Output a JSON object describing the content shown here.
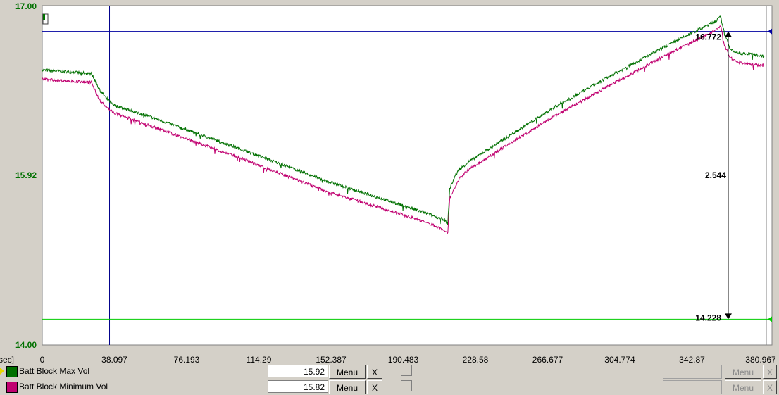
{
  "chart_data": {
    "type": "line",
    "x_axis": {
      "unit_label": "sec]",
      "range": [
        0,
        380.967
      ],
      "tick_labels": [
        "0",
        "38.097",
        "76.193",
        "114.29",
        "152.387",
        "190.483",
        "228.58",
        "266.677",
        "304.774",
        "342.87",
        "380.967"
      ]
    },
    "y_axis": {
      "range": [
        14.0,
        17.0
      ],
      "tick_labels": [
        "17.00",
        "15.92",
        "14.00"
      ],
      "tick_values": [
        17.0,
        15.92,
        14.0
      ]
    },
    "grid": false,
    "series": [
      {
        "name": "Batt Block Max Vol",
        "color": "#007000",
        "x": [
          0,
          26,
          28,
          30,
          34,
          38,
          60,
          100,
          150,
          200,
          212,
          214,
          215,
          218,
          220,
          225,
          240,
          270,
          300,
          330,
          355,
          358,
          360,
          363,
          367,
          375,
          380.967
        ],
        "y": [
          16.43,
          16.4,
          16.34,
          16.26,
          16.18,
          16.12,
          16.0,
          15.76,
          15.45,
          15.18,
          15.11,
          15.07,
          15.38,
          15.5,
          15.55,
          15.62,
          15.78,
          16.1,
          16.38,
          16.65,
          16.86,
          16.9,
          16.75,
          16.62,
          16.58,
          16.57,
          16.55
        ]
      },
      {
        "name": "Batt Block Minimum Vol",
        "color": "#c00070",
        "x": [
          0,
          26,
          28,
          30,
          34,
          38,
          60,
          100,
          150,
          200,
          212,
          214,
          215,
          218,
          220,
          225,
          240,
          270,
          300,
          330,
          355,
          358,
          360,
          363,
          367,
          375,
          380.967
        ],
        "y": [
          16.35,
          16.32,
          16.25,
          16.17,
          16.1,
          16.05,
          15.92,
          15.68,
          15.36,
          15.1,
          15.02,
          14.98,
          15.3,
          15.4,
          15.47,
          15.55,
          15.71,
          16.02,
          16.3,
          16.57,
          16.78,
          16.82,
          16.65,
          16.54,
          16.5,
          16.48,
          16.47
        ]
      }
    ],
    "cursors": {
      "vertical_x": 35.5,
      "horizontal_upper": 16.772,
      "horizontal_lower": 14.228,
      "measure_x": 362,
      "upper_label": "16.772",
      "lower_label": "14.228",
      "delta_label": "2.544",
      "colors": {
        "vertical": "#00008b",
        "upper": "#0000a0",
        "lower": "#00cc00"
      }
    }
  },
  "legend": [
    {
      "label": "Batt Block Max Vol",
      "color": "#007000",
      "value": "15.92",
      "menu": "Menu",
      "close": "X",
      "selected": true
    },
    {
      "label": "Batt Block Minimum Vol",
      "color": "#c00070",
      "value": "15.82",
      "menu": "Menu",
      "close": "X",
      "selected": false
    }
  ],
  "right_panel": {
    "menu": "Menu",
    "close": "X"
  }
}
